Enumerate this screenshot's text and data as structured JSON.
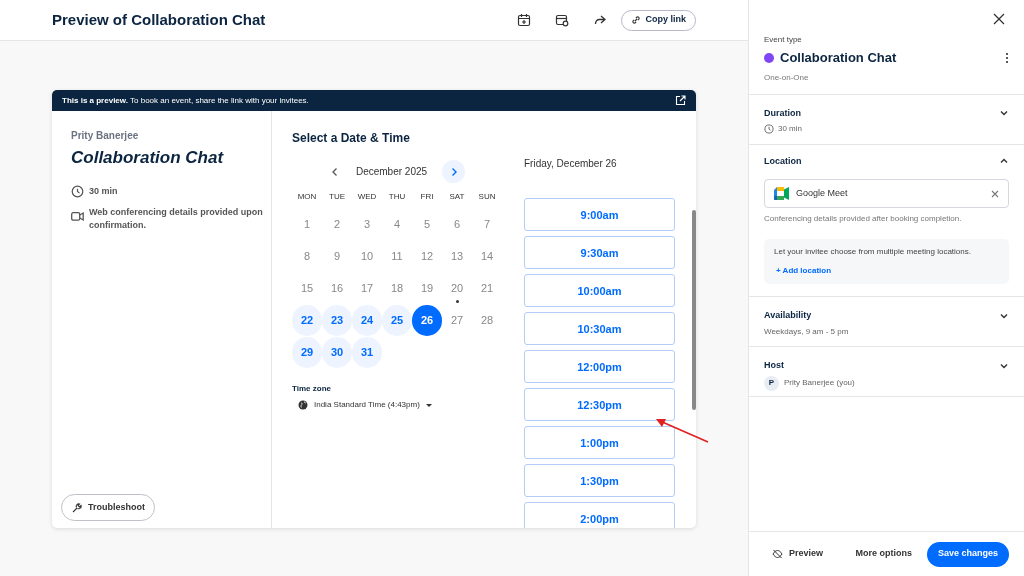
{
  "header": {
    "title": "Preview of Collaboration Chat",
    "copy_link": "Copy link"
  },
  "preview_banner": "**This is a preview.** To book an event, share the link with your invitees.",
  "event_info": {
    "host": "Prity Banerjee",
    "title": "Collaboration Chat",
    "duration": "30 min",
    "location": "Web conferencing details provided upon confirmation."
  },
  "troubleshoot": "Troubleshoot",
  "scheduler": {
    "heading": "Select a Date & Time",
    "month": "December 2025",
    "weekdays": [
      "MON",
      "TUE",
      "WED",
      "THU",
      "FRI",
      "SAT",
      "SUN"
    ],
    "days": [
      {
        "label": "1",
        "available": false,
        "selected": false,
        "today": false
      },
      {
        "label": "2",
        "available": false,
        "selected": false,
        "today": false
      },
      {
        "label": "3",
        "available": false,
        "selected": false,
        "today": false
      },
      {
        "label": "4",
        "available": false,
        "selected": false,
        "today": false
      },
      {
        "label": "5",
        "available": false,
        "selected": false,
        "today": false
      },
      {
        "label": "6",
        "available": false,
        "selected": false,
        "today": false
      },
      {
        "label": "7",
        "available": false,
        "selected": false,
        "today": false
      },
      {
        "label": "8",
        "available": false,
        "selected": false,
        "today": false
      },
      {
        "label": "9",
        "available": false,
        "selected": false,
        "today": false
      },
      {
        "label": "10",
        "available": false,
        "selected": false,
        "today": false
      },
      {
        "label": "11",
        "available": false,
        "selected": false,
        "today": false
      },
      {
        "label": "12",
        "available": false,
        "selected": false,
        "today": false
      },
      {
        "label": "13",
        "available": false,
        "selected": false,
        "today": false
      },
      {
        "label": "14",
        "available": false,
        "selected": false,
        "today": false
      },
      {
        "label": "15",
        "available": false,
        "selected": false,
        "today": false
      },
      {
        "label": "16",
        "available": false,
        "selected": false,
        "today": false
      },
      {
        "label": "17",
        "available": false,
        "selected": false,
        "today": false
      },
      {
        "label": "18",
        "available": false,
        "selected": false,
        "today": false
      },
      {
        "label": "19",
        "available": false,
        "selected": false,
        "today": false
      },
      {
        "label": "20",
        "available": false,
        "selected": false,
        "today": true
      },
      {
        "label": "21",
        "available": false,
        "selected": false,
        "today": false
      },
      {
        "label": "22",
        "available": true,
        "selected": false,
        "today": false
      },
      {
        "label": "23",
        "available": true,
        "selected": false,
        "today": false
      },
      {
        "label": "24",
        "available": true,
        "selected": false,
        "today": false
      },
      {
        "label": "25",
        "available": true,
        "selected": false,
        "today": false
      },
      {
        "label": "26",
        "available": true,
        "selected": true,
        "today": false
      },
      {
        "label": "27",
        "available": false,
        "selected": false,
        "today": false
      },
      {
        "label": "28",
        "available": false,
        "selected": false,
        "today": false
      },
      {
        "label": "29",
        "available": true,
        "selected": false,
        "today": false
      },
      {
        "label": "30",
        "available": true,
        "selected": false,
        "today": false
      },
      {
        "label": "31",
        "available": true,
        "selected": false,
        "today": false
      }
    ],
    "timezone_label": "Time zone",
    "timezone": "India Standard Time (4:43pm)",
    "date_heading": "Friday, December 26",
    "slots": [
      "9:00am",
      "9:30am",
      "10:00am",
      "10:30am",
      "12:00pm",
      "12:30pm",
      "1:00pm",
      "1:30pm",
      "2:00pm"
    ]
  },
  "panel": {
    "event_type_label": "Event type",
    "event_name": "Collaboration Chat",
    "color": "#8247f5",
    "event_kind": "One-on-One",
    "sections": [
      {
        "kind": "duration",
        "title": "Duration",
        "expanded": false,
        "value": "30 min"
      },
      {
        "kind": "location",
        "title": "Location",
        "expanded": true,
        "value": "Google Meet",
        "note": "Conferencing details provided after booking completion.",
        "hint": "Let your invitee choose from multiple meeting locations.",
        "action": "+ Add location"
      },
      {
        "kind": "availability",
        "title": "Availability",
        "expanded": false,
        "value": "Weekdays, 9 am - 5 pm"
      },
      {
        "kind": "host",
        "title": "Host",
        "expanded": false,
        "initial": "P",
        "value": "Prity Banerjee (you)"
      }
    ],
    "footer": {
      "preview": "Preview",
      "more": "More options",
      "save": "Save changes"
    }
  }
}
